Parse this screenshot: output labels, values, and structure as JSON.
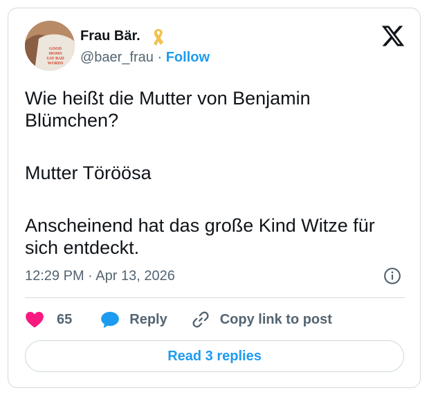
{
  "author": {
    "name": "Frau Bär.",
    "handle": "@baer_frau",
    "follow_label": "Follow",
    "avatar_shirt_text": "GOOD MOMS SAY BAD WORDS"
  },
  "tweet": {
    "paragraphs": [
      "Wie heißt die Mutter von Benjamin Blümchen?",
      "Mutter Töröösa",
      "Anscheinend hat das große Kind Witze für sich entdeckt."
    ],
    "time": "12:29 PM",
    "date": "Apr 13, 2026"
  },
  "actions": {
    "likes": "65",
    "reply_label": "Reply",
    "copy_label": "Copy link to post"
  },
  "read_replies_label": "Read 3 replies",
  "colors": {
    "accent": "#1d9bf0",
    "like": "#f91880",
    "text": "#0f1419",
    "secondary": "#536471",
    "ribbon": "#f2c14e"
  },
  "icons": [
    "gold-ribbon-icon",
    "x-logo-icon",
    "info-icon",
    "heart-icon",
    "reply-bubble-icon",
    "link-icon"
  ]
}
